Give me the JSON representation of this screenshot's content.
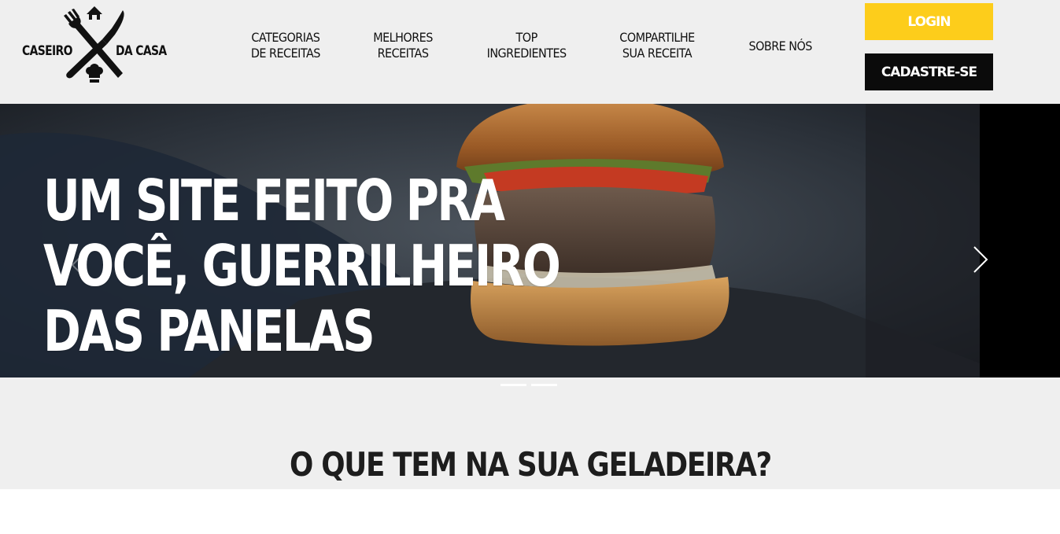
{
  "brand": {
    "left": "CASEIRO",
    "right": "DA CASA"
  },
  "nav": {
    "categories": [
      "CATEGORIAS",
      "DE RECEITAS"
    ],
    "best": [
      "MELHORES",
      "RECEITAS"
    ],
    "top": [
      "TOP",
      "INGREDIENTES"
    ],
    "share": [
      "COMPARTILHE",
      "SUA RECEITA"
    ],
    "about": [
      "SOBRE NÓS"
    ]
  },
  "auth": {
    "login": "LOGIN",
    "signup": "CADASTRE-SE"
  },
  "hero": {
    "lines": [
      "UM SITE FEITO PRA",
      "VOCÊ, GUERRILHEIRO",
      "DAS PANELAS"
    ],
    "slide_count": 2
  },
  "section": {
    "title": "O QUE TEM NA SUA GELADEIRA?"
  },
  "colors": {
    "accent": "#fdcd1b",
    "dark": "#0b0b0b",
    "background": "#efefef"
  },
  "icons": [
    "logo-icon",
    "chevron-left-icon",
    "chevron-right-icon"
  ]
}
